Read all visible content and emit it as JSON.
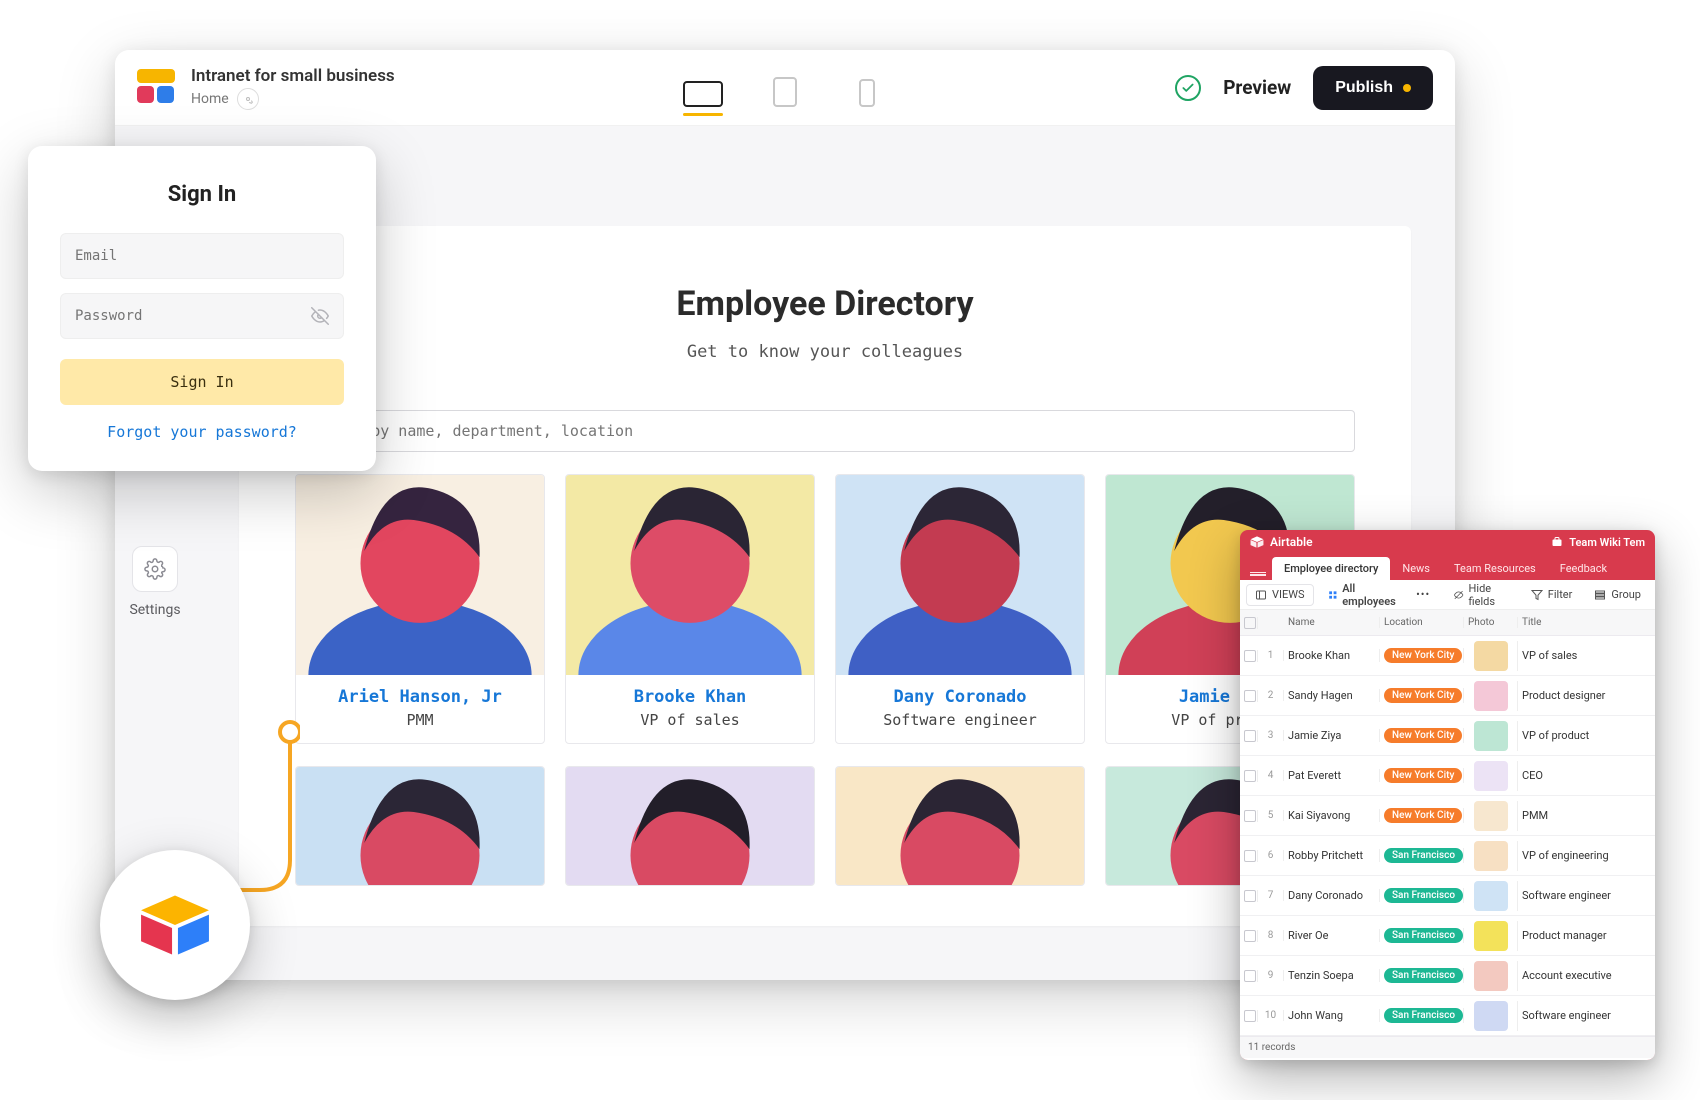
{
  "builder": {
    "title": "Intranet for small business",
    "breadcrumb": "Home",
    "preview": "Preview",
    "publish": "Publish",
    "settings": "Settings"
  },
  "site": {
    "heading": "Employee Directory",
    "sub": "Get to know your colleagues",
    "search_placeholder": "Search by name, department, location",
    "employees": [
      {
        "name": "Ariel Hanson, Jr",
        "role": "PMM",
        "bg": "#f8efe2",
        "skin": "#e2465f",
        "hair": "#35243f",
        "shirt": "#3b63c6"
      },
      {
        "name": "Brooke Khan",
        "role": "VP of sales",
        "bg": "#f3e9a5",
        "skin": "#dd4c67",
        "hair": "#2a2534",
        "shirt": "#5a87e8"
      },
      {
        "name": "Dany Coronado",
        "role": "Software engineer",
        "bg": "#cfe3f5",
        "skin": "#c33b51",
        "hair": "#2c2636",
        "shirt": "#3f60c5"
      },
      {
        "name": "Jamie Ziya",
        "role": "VP of product",
        "bg": "#bfe7d2",
        "skin": "#f2c84f",
        "hair": "#231f2a",
        "shirt": "#d04057"
      }
    ],
    "row2": [
      {
        "bg": "#c9e0f3",
        "skin": "#d94a63",
        "hair": "#2b2636",
        "shirt": "#4a6fd4"
      },
      {
        "bg": "#e3dbf2",
        "skin": "#d94a63",
        "hair": "#221e29",
        "shirt": "#3856b4"
      },
      {
        "bg": "#f9e7c6",
        "skin": "#d94a63",
        "hair": "#2b2534",
        "shirt": "#4e71d2"
      },
      {
        "bg": "#c7e9dc",
        "skin": "#d94a63",
        "hair": "#2b2534",
        "shirt": "#4e71d2"
      }
    ]
  },
  "signin": {
    "title": "Sign In",
    "email_ph": "Email",
    "password_ph": "Password",
    "button": "Sign In",
    "forgot": "Forgot your password?"
  },
  "airtable": {
    "brand": "Airtable",
    "workspace": "Team Wiki Tem",
    "tabs": [
      "Employee directory",
      "News",
      "Team Resources",
      "Feedback"
    ],
    "active_tab": 0,
    "views_label": "VIEWS",
    "view_name": "All employees",
    "toolbar": {
      "hide": "Hide fields",
      "filter": "Filter",
      "group": "Group"
    },
    "columns": [
      "Name",
      "Location",
      "Photo",
      "Title"
    ],
    "rows": [
      {
        "n": 1,
        "name": "Brooke Khan",
        "loc": "New York City",
        "loc_cls": "loc-ny",
        "title": "VP of sales",
        "av": "#f4d9a3"
      },
      {
        "n": 2,
        "name": "Sandy Hagen",
        "loc": "New York City",
        "loc_cls": "loc-ny",
        "title": "Product designer",
        "av": "#f4c8d7"
      },
      {
        "n": 3,
        "name": "Jamie Ziya",
        "loc": "New York City",
        "loc_cls": "loc-ny",
        "title": "VP of product",
        "av": "#bde6d4"
      },
      {
        "n": 4,
        "name": "Pat Everett",
        "loc": "New York City",
        "loc_cls": "loc-ny",
        "title": "CEO",
        "av": "#ece3f5"
      },
      {
        "n": 5,
        "name": "Kai Siyavong",
        "loc": "New York City",
        "loc_cls": "loc-ny",
        "title": "PMM",
        "av": "#f7e7cf"
      },
      {
        "n": 6,
        "name": "Robby Pritchett",
        "loc": "San Francisco",
        "loc_cls": "loc-sf",
        "title": "VP of engineering",
        "av": "#f7e0c3"
      },
      {
        "n": 7,
        "name": "Dany Coronado",
        "loc": "San Francisco",
        "loc_cls": "loc-sf",
        "title": "Software engineer",
        "av": "#cfe3f5"
      },
      {
        "n": 8,
        "name": "River Oe",
        "loc": "San Francisco",
        "loc_cls": "loc-sf",
        "title": "Product manager",
        "av": "#f3e25a"
      },
      {
        "n": 9,
        "name": "Tenzin Soepa",
        "loc": "San Francisco",
        "loc_cls": "loc-sf",
        "title": "Account executive",
        "av": "#f3c9c0"
      },
      {
        "n": 10,
        "name": "John Wang",
        "loc": "San Francisco",
        "loc_cls": "loc-sf",
        "title": "Software engineer",
        "av": "#cfd9f3"
      }
    ],
    "footer": "11 records"
  }
}
